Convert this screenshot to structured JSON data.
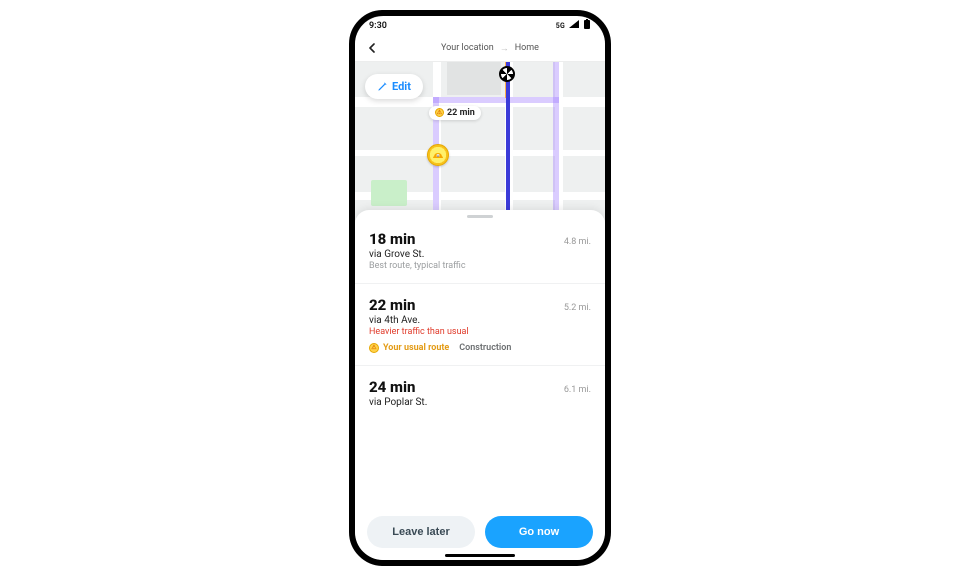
{
  "status_bar": {
    "time": "9:30",
    "network": "5G"
  },
  "header": {
    "from": "Your location",
    "to": "Home"
  },
  "map": {
    "edit_label": "Edit",
    "alt_time_label": "22 min"
  },
  "routes": [
    {
      "time": "18 min",
      "distance": "4.8 mi.",
      "via": "via Grove St.",
      "note_muted": "Best route, typical traffic"
    },
    {
      "time": "22 min",
      "distance": "5.2 mi.",
      "via": "via 4th Ave.",
      "note_red": "Heavier traffic than usual",
      "tag_usual": "Your usual route",
      "tag_construction": "Construction"
    },
    {
      "time": "24 min",
      "distance": "6.1 mi.",
      "via": "via Poplar St."
    }
  ],
  "footer": {
    "leave_later": "Leave later",
    "go_now": "Go now"
  },
  "colors": {
    "primary": "#1aa3ff",
    "danger": "#e03a2a",
    "warning": "#e39b15"
  }
}
